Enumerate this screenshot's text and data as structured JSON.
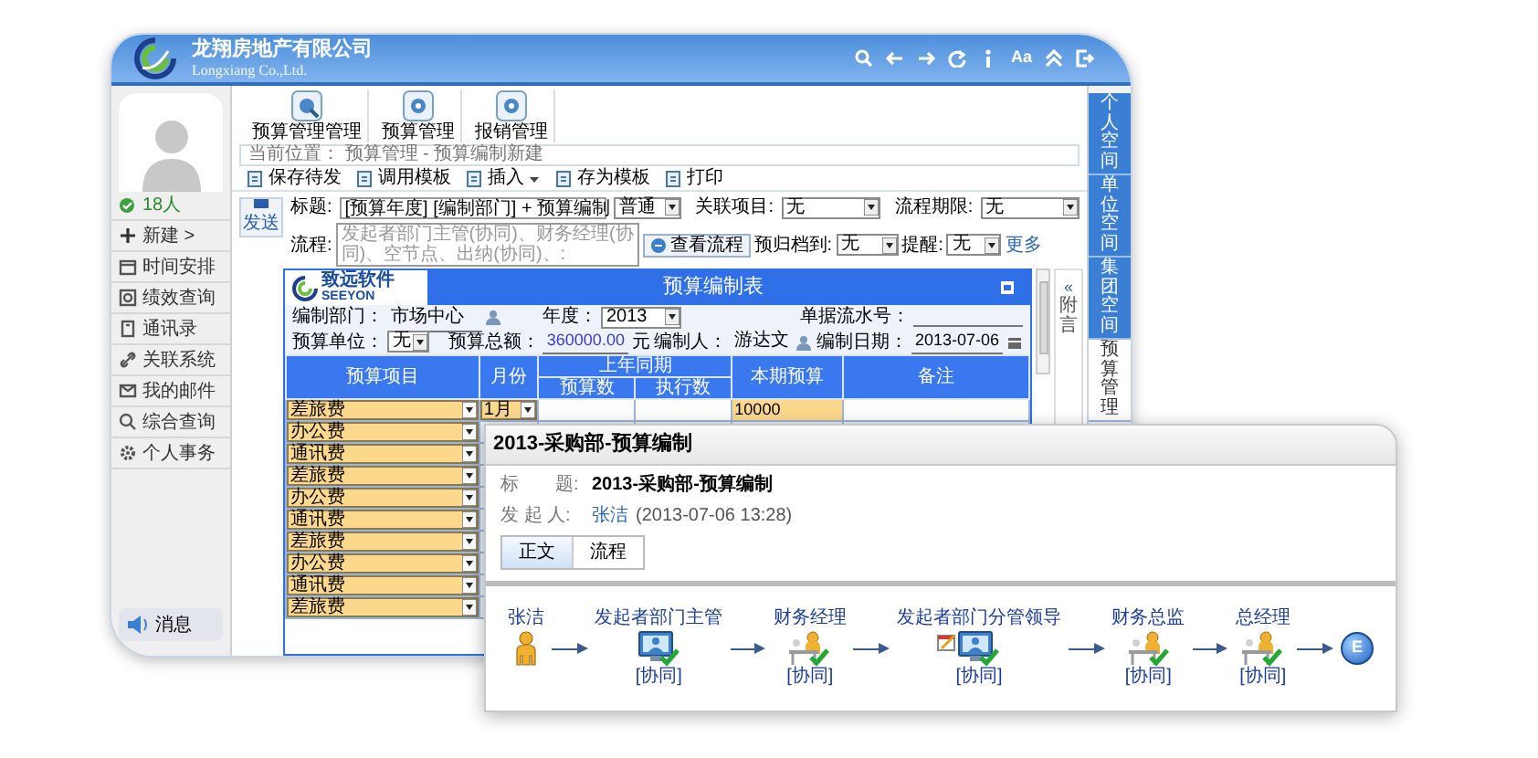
{
  "header": {
    "company": "龙翔房地产有限公司",
    "subtitle": "Longxiang Co.,Ltd.",
    "font_toggle": "Aa"
  },
  "sidebar": {
    "online": "18人",
    "items": [
      {
        "label": "新建 >"
      },
      {
        "label": "时间安排"
      },
      {
        "label": "绩效查询"
      },
      {
        "label": "通讯录"
      },
      {
        "label": "关联系统"
      },
      {
        "label": "我的邮件"
      },
      {
        "label": "综合查询"
      },
      {
        "label": "个人事务"
      }
    ],
    "message": "消息"
  },
  "modules": [
    {
      "label": "预算管理管理"
    },
    {
      "label": "预算管理"
    },
    {
      "label": "报销管理"
    }
  ],
  "breadcrumb": "当前位置： 预算管理 - 预算编制新建",
  "actions": [
    {
      "label": "保存待发",
      "dropdown": false
    },
    {
      "label": "调用模板",
      "dropdown": false
    },
    {
      "label": "插入",
      "dropdown": true
    },
    {
      "label": "存为模板",
      "dropdown": false
    },
    {
      "label": "打印",
      "dropdown": false
    }
  ],
  "send_button": "发送",
  "subject": {
    "label": "标题:",
    "value": "[预算年度] [编制部门] + 预算编制"
  },
  "priority": "普通",
  "related_project": {
    "label": "关联项目:",
    "value": "无"
  },
  "deadline": {
    "label": "流程期限:",
    "value": "无"
  },
  "workflow": {
    "label": "流程:",
    "placeholder": "发起者部门主管(协同)、财务经理(协同)、空节点、出纳(协同)、:"
  },
  "view_flow_button": "查看流程",
  "archive": {
    "label": "预归档到:",
    "value": "无"
  },
  "reminder": {
    "label": "提醒:",
    "value": "无"
  },
  "more_link": "更多",
  "form": {
    "logo": "致远软件",
    "logo_sub": "SEEYON",
    "title": "预算编制表",
    "department": {
      "label": "编制部门：",
      "value": "市场中心"
    },
    "year": {
      "label": "年度：",
      "value": "2013"
    },
    "serial": {
      "label": "单据流水号："
    },
    "unit": {
      "label": "预算单位：",
      "value": "无"
    },
    "total": {
      "label": "预算总额：",
      "value": "360000.00",
      "unit": "元"
    },
    "author": {
      "label": "编制人：",
      "value": "游达文"
    },
    "date": {
      "label": "编制日期：",
      "value": "2013-07-06"
    },
    "columns": {
      "item": "预算项目",
      "month": "月份",
      "last_year": "上年同期",
      "budget": "预算数",
      "actual": "执行数",
      "current": "本期预算",
      "note": "备注"
    },
    "rows": [
      {
        "item": "差旅费",
        "month": "1月",
        "current": "10000"
      },
      {
        "item": "办公费"
      },
      {
        "item": "通讯费"
      },
      {
        "item": "差旅费"
      },
      {
        "item": "办公费"
      },
      {
        "item": "通讯费"
      },
      {
        "item": "差旅费"
      },
      {
        "item": "办公费"
      },
      {
        "item": "通讯费"
      },
      {
        "item": "差旅费"
      }
    ]
  },
  "attachment_panel": {
    "collapse": "«",
    "label": "附言"
  },
  "right_tabs": [
    {
      "label": "个人空间",
      "selected": false
    },
    {
      "label": "单位空间",
      "selected": false
    },
    {
      "label": "集团空间",
      "selected": false
    },
    {
      "label": "预算管理",
      "selected": true
    }
  ],
  "detail": {
    "window_title": "2013-采购部-预算编制",
    "subject": {
      "label": "标　　题:",
      "value": "2013-采购部-预算编制"
    },
    "sender": {
      "label": "发 起 人:",
      "name": "张洁",
      "time": "(2013-07-06 13:28)"
    },
    "tabs": [
      {
        "label": "正文",
        "selected": true
      },
      {
        "label": "流程",
        "selected": false
      }
    ],
    "flow": [
      {
        "kind": "person",
        "name": "张洁",
        "note": false
      },
      {
        "kind": "monitor",
        "name": "发起者部门主管",
        "tag": "[协同]",
        "note": false
      },
      {
        "kind": "desk",
        "name": "财务经理",
        "tag": "[协同]",
        "note": false
      },
      {
        "kind": "monitor",
        "name": "发起者部门分管领导",
        "tag": "[协同]",
        "note": true
      },
      {
        "kind": "desk",
        "name": "财务总监",
        "tag": "[协同]",
        "note": false
      },
      {
        "kind": "desk",
        "name": "总经理",
        "tag": "[协同]",
        "note": false
      },
      {
        "kind": "end",
        "name": "E"
      }
    ]
  }
}
